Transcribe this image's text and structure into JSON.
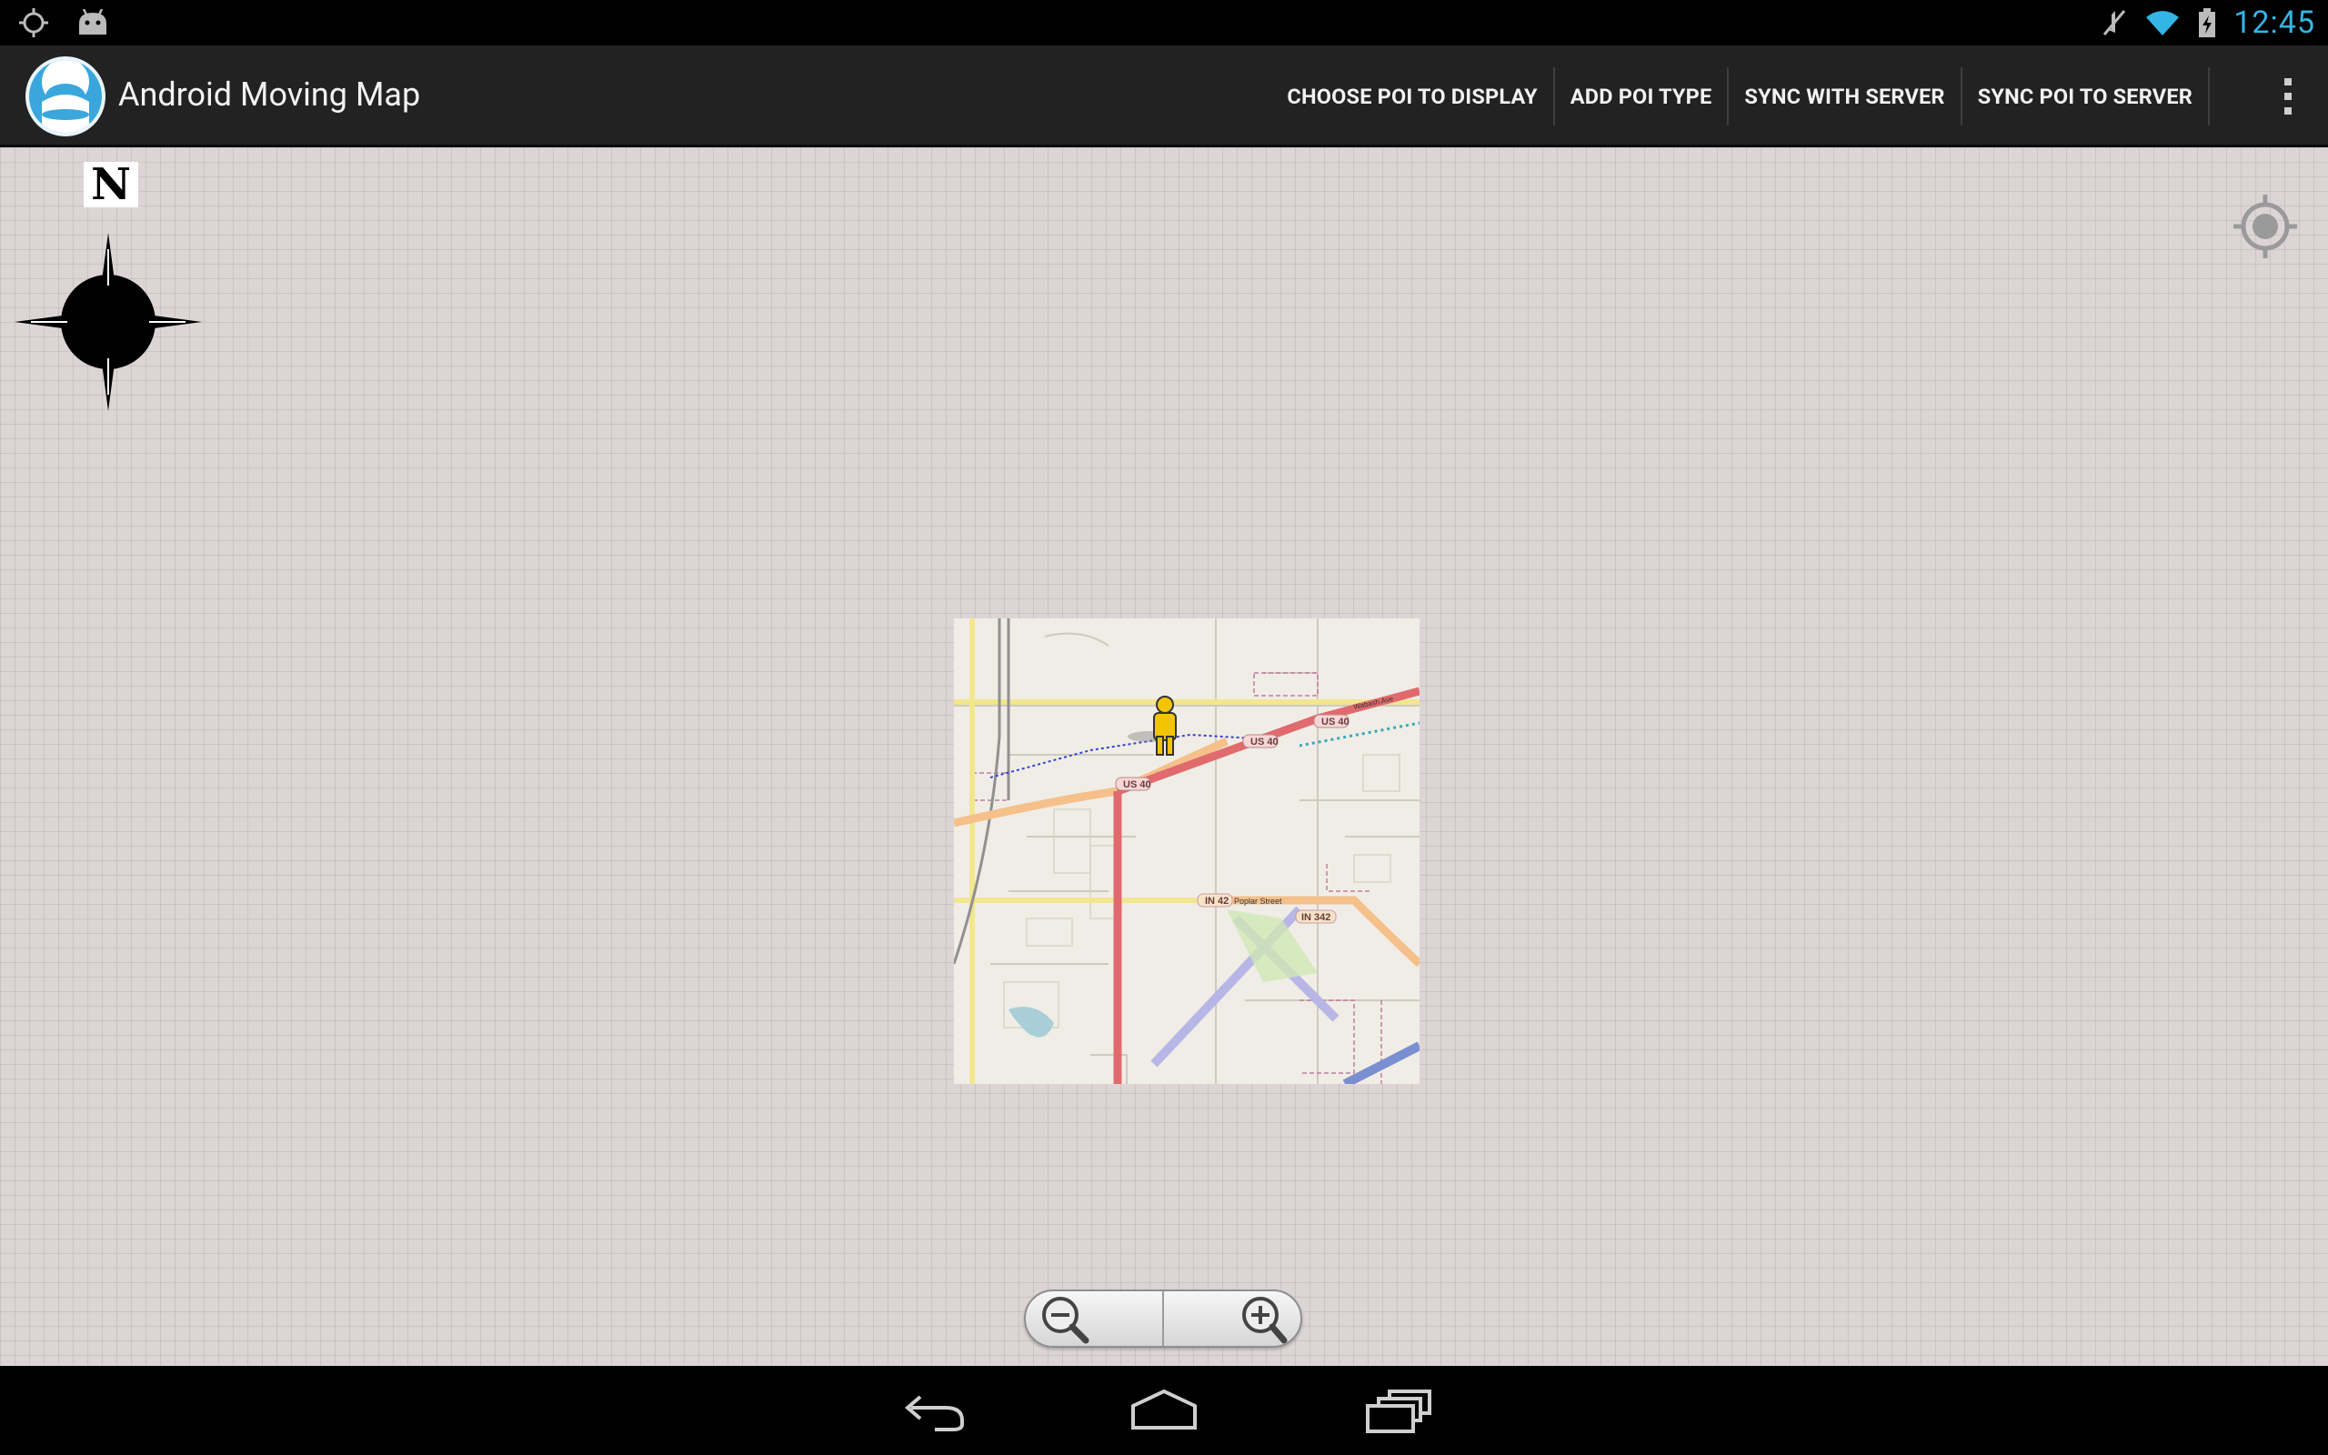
{
  "status_bar": {
    "left_icons": [
      "gps-icon",
      "android-debug-icon"
    ],
    "right_icons": [
      "mute-icon",
      "wifi-icon",
      "battery-charging-icon"
    ],
    "clock": "12:45"
  },
  "action_bar": {
    "title": "Android Moving Map",
    "actions": [
      "CHOOSE POI TO DISPLAY",
      "ADD POI TYPE",
      "SYNC WITH SERVER",
      "SYNC POI TO SERVER"
    ],
    "overflow_icon": "overflow-menu-icon"
  },
  "map": {
    "compass_label": "N",
    "road_labels": [
      "US 40",
      "US 40",
      "US 40",
      "IN 42",
      "IN 342",
      "Poplar Street",
      "Wabash Ave"
    ],
    "colors": {
      "background": "#ddd5d5",
      "primary_road": "#e06a6e",
      "secondary_road": "#f5c08a",
      "tile_background": "#f0ede6",
      "accent": "#33b5e5"
    }
  },
  "zoom_controls": {
    "zoom_out": "zoom-out-icon",
    "zoom_in": "zoom-in-icon"
  },
  "nav_bar": {
    "buttons": [
      "back-icon",
      "home-icon",
      "recent-apps-icon"
    ]
  }
}
